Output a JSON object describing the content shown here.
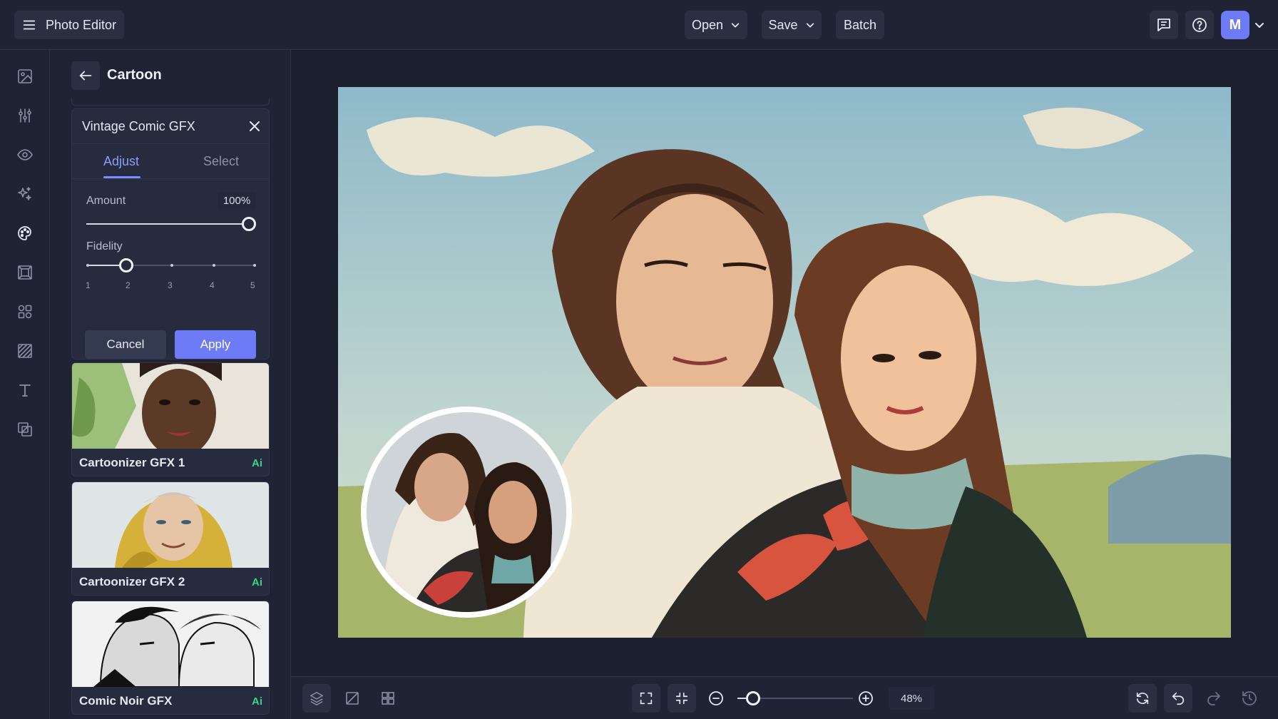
{
  "app": {
    "title": "Photo Editor"
  },
  "topbar": {
    "open_label": "Open",
    "save_label": "Save",
    "batch_label": "Batch",
    "avatar_initial": "M"
  },
  "rail": {
    "icons": [
      "image-icon",
      "sliders-icon",
      "eye-icon",
      "sparkles-icon",
      "palette-icon",
      "frame-icon",
      "shapes-icon",
      "texture-icon",
      "text-icon",
      "overlay-icon"
    ]
  },
  "panel": {
    "title": "Cartoon",
    "effect_name": "Vintage Comic GFX",
    "tabs": {
      "adjust": "Adjust",
      "select": "Select"
    },
    "amount": {
      "label": "Amount",
      "value": "100%",
      "level": 1.0
    },
    "fidelity": {
      "label": "Fidelity",
      "ticks": [
        "1",
        "2",
        "3",
        "4",
        "5"
      ],
      "value": 2
    },
    "buttons": {
      "cancel": "Cancel",
      "apply": "Apply"
    },
    "presets": [
      {
        "name": "Cartoonizer GFX 1",
        "badge": "Ai"
      },
      {
        "name": "Cartoonizer GFX 2",
        "badge": "Ai"
      },
      {
        "name": "Comic Noir GFX",
        "badge": "Ai"
      }
    ]
  },
  "bottombar": {
    "zoom_value": "48%",
    "zoom_level": 0.06
  },
  "colors": {
    "accent": "#6d7bf6",
    "ai_badge": "#39d38a",
    "background": "#1f2334"
  }
}
